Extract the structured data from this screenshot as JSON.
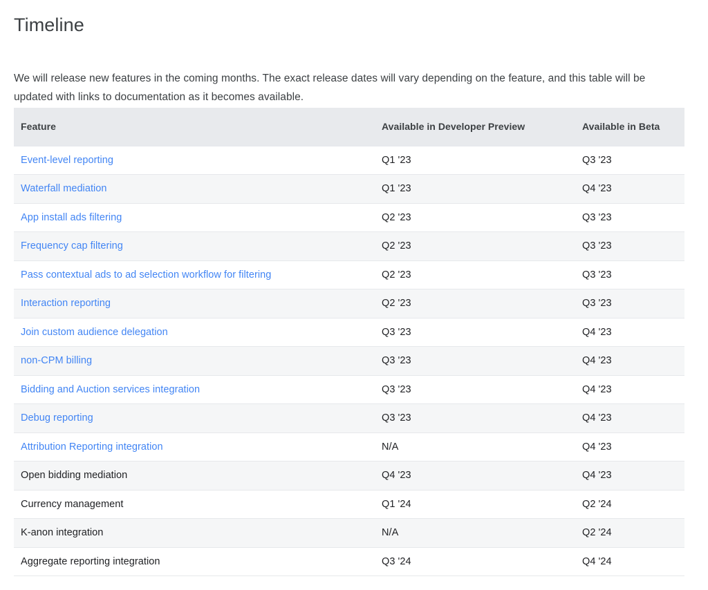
{
  "page": {
    "title": "Timeline",
    "intro": "We will release new features in the coming months. The exact release dates will vary depending on the feature, and this table will be updated with links to documentation as it becomes available."
  },
  "colors": {
    "link": "#4285f4",
    "header_background": "#e8eaed",
    "alt_row_background": "#f5f6f7",
    "text": "#202124",
    "heading": "#3c4043",
    "row_border": "#e6e8eb"
  },
  "table": {
    "columns": [
      {
        "key": "feature",
        "label": "Feature"
      },
      {
        "key": "developer_preview",
        "label": "Available in Developer Preview"
      },
      {
        "key": "beta",
        "label": "Available in Beta"
      }
    ],
    "rows": [
      {
        "feature": "Event-level reporting",
        "is_link": true,
        "developer_preview": "Q1 '23",
        "beta": "Q3 '23"
      },
      {
        "feature": "Waterfall mediation",
        "is_link": true,
        "developer_preview": "Q1 '23",
        "beta": "Q4 '23"
      },
      {
        "feature": "App install ads filtering",
        "is_link": true,
        "developer_preview": "Q2 '23",
        "beta": "Q3 '23"
      },
      {
        "feature": "Frequency cap filtering",
        "is_link": true,
        "developer_preview": "Q2 '23",
        "beta": "Q3 '23"
      },
      {
        "feature": "Pass contextual ads to ad selection workflow for filtering",
        "is_link": true,
        "developer_preview": "Q2 '23",
        "beta": "Q3 '23"
      },
      {
        "feature": "Interaction reporting",
        "is_link": true,
        "developer_preview": "Q2 '23",
        "beta": "Q3 '23"
      },
      {
        "feature": "Join custom audience delegation",
        "is_link": true,
        "developer_preview": "Q3 '23",
        "beta": "Q4 '23"
      },
      {
        "feature": "non-CPM billing",
        "is_link": true,
        "developer_preview": "Q3 '23",
        "beta": "Q4 '23"
      },
      {
        "feature": "Bidding and Auction services integration",
        "is_link": true,
        "developer_preview": "Q3 '23",
        "beta": "Q4 '23"
      },
      {
        "feature": "Debug reporting",
        "is_link": true,
        "developer_preview": "Q3 '23",
        "beta": "Q4 '23"
      },
      {
        "feature": "Attribution Reporting integration",
        "is_link": true,
        "developer_preview": "N/A",
        "beta": "Q4 '23"
      },
      {
        "feature": "Open bidding mediation",
        "is_link": false,
        "developer_preview": "Q4 '23",
        "beta": "Q4 '23"
      },
      {
        "feature": "Currency management",
        "is_link": false,
        "developer_preview": "Q1 '24",
        "beta": "Q2 '24"
      },
      {
        "feature": "K-anon integration",
        "is_link": false,
        "developer_preview": "N/A",
        "beta": "Q2 '24"
      },
      {
        "feature": "Aggregate reporting integration",
        "is_link": false,
        "developer_preview": "Q3 '24",
        "beta": "Q4 '24"
      }
    ]
  }
}
